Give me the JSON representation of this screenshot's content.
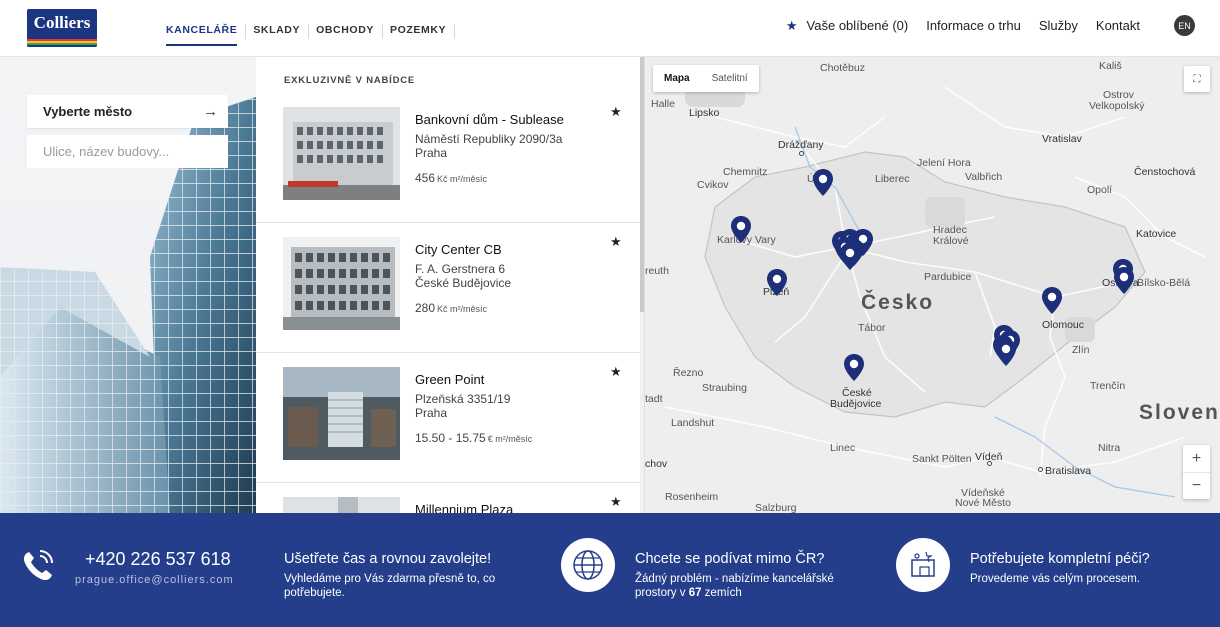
{
  "header": {
    "logo_text": "Colliers",
    "tabs": [
      {
        "label": "KANCELÁŘE",
        "active": true
      },
      {
        "label": "SKLADY",
        "active": false
      },
      {
        "label": "OBCHODY",
        "active": false
      },
      {
        "label": "POZEMKY",
        "active": false
      }
    ],
    "favorites_label": "Vaše oblíbené (0)",
    "links": [
      "Informace o trhu",
      "Služby",
      "Kontakt"
    ],
    "lang": "EN",
    "accent": "#1c3580"
  },
  "search": {
    "city_select": "Vyberte město",
    "street_placeholder": "Ulice, název budovy..."
  },
  "listing": {
    "heading": "EXKLUZIVNĚ V NABÍDCE",
    "items": [
      {
        "name": "Bankovní dům - Sublease",
        "address": "Náměstí Republiky 2090/3a",
        "city": "Praha",
        "price": "456",
        "unit": "Kč m²/měsíc"
      },
      {
        "name": "City Center CB",
        "address": "F. A. Gerstnera 6",
        "city": "České Budějovice",
        "price": "280",
        "unit": "Kč m²/měsíc"
      },
      {
        "name": "Green Point",
        "address": "Plzeňská 3351/19",
        "city": "Praha",
        "price": "15.50 - 15.75",
        "unit": "€ m²/měsíc"
      },
      {
        "name": "Millennium Plaza",
        "address": "",
        "city": "",
        "price": "",
        "unit": ""
      }
    ]
  },
  "map": {
    "type_map": "Mapa",
    "type_satellite": "Satelitní",
    "labels": {
      "chotebuz": "Chotěbuz",
      "kalis": "Kališ",
      "halle": "Halle",
      "lipsko": "Lipsko",
      "ostrov": "Ostrov",
      "velkopolsky": "Velkopolský",
      "drazdany": "Drážďany",
      "vratislav": "Vratislav",
      "jelenihora": "Jelení Hora",
      "chemnitz": "Chemnitz",
      "usti": "Ústí",
      "usti2": "n. L.",
      "liberec": "Liberec",
      "valbrich": "Valbřich",
      "censtochova": "Čenstochová",
      "cvikov": "Cvikov",
      "opoli": "Opolí",
      "hradec": "Hradec",
      "kralove": "Králové",
      "katovice": "Katovice",
      "karlovy": "Karlovy Vary",
      "pardubice": "Pardubice",
      "reuth": "reuth",
      "bielsko": "Bílsko-Bělá",
      "plzen": "Plzeň",
      "ostrava": "Ostrava",
      "cesko": "Česko",
      "olomouc": "Olomouc",
      "tabor": "Tábor",
      "zlin": "Zlín",
      "rezno": "Řezno",
      "ceske": "České",
      "budejovice": "Budějovice",
      "straubing": "Straubing",
      "tadt": "tadt",
      "trencin": "Trenčín",
      "landshut": "Landshut",
      "slovensko": "Sloven",
      "linec": "Linec",
      "nitra": "Nitra",
      "chov": "chov",
      "sanktpolten": "Sankt Pölten",
      "viden": "Vídeň",
      "bratislava": "Bratislava",
      "rosenheim": "Rosenheim",
      "videnske": "Vídeňské",
      "novemesto": "Nové Město",
      "salzburg": "Salzburg"
    },
    "zoom_in": "+",
    "zoom_out": "−",
    "pin_color": "#1e2f7a"
  },
  "footer": {
    "phone": "+420 226 537 618",
    "email": "prague.office@colliers.com",
    "blocks": [
      {
        "title": "Ušetřete čas a rovnou zavolejte!",
        "text": "Vyhledáme pro Vás zdarma přesně to, co potřebujete."
      },
      {
        "title": "Chcete se podívat mimo ČR?",
        "text_before": "Žádný problém - nabízíme kancelářské prostory v ",
        "count": "67",
        "text_after": " zemích"
      },
      {
        "title": "Potřebujete kompletní péči?",
        "text": "Provedeme vás celým procesem."
      }
    ],
    "bg_color": "#253e8c"
  }
}
